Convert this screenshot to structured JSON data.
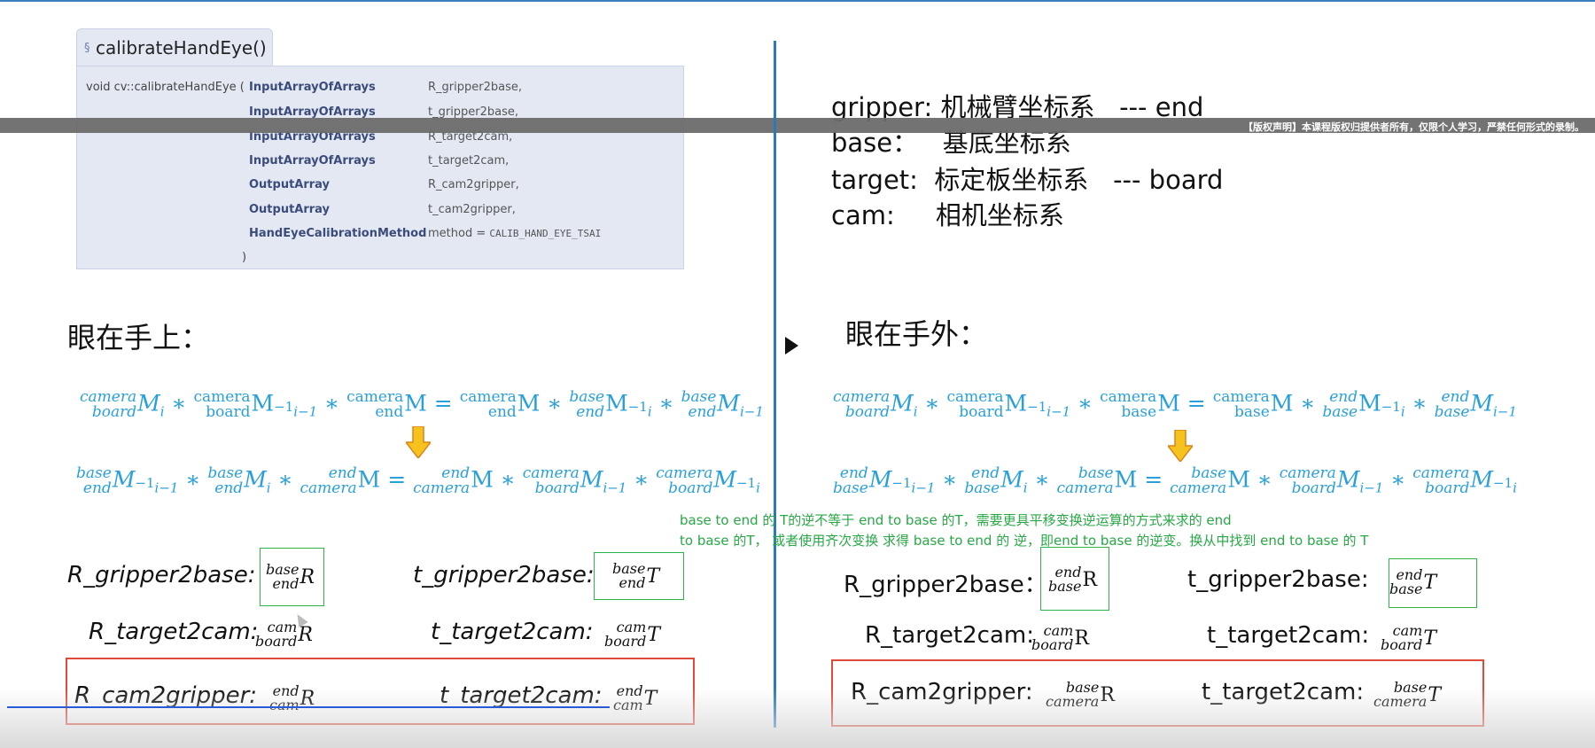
{
  "api": {
    "section_mark": "§",
    "function_title": "calibrateHandEye()",
    "signature": "void cv::calibrateHandEye (",
    "params": [
      {
        "type": "InputArrayOfArrays",
        "name": "R_gripper2base,"
      },
      {
        "type": "InputArrayOfArrays",
        "name": "t_gripper2base,"
      },
      {
        "type": "InputArrayOfArrays",
        "name": "R_target2cam,"
      },
      {
        "type": "InputArrayOfArrays",
        "name": "t_target2cam,"
      },
      {
        "type": "OutputArray",
        "name": "R_cam2gripper,"
      },
      {
        "type": "OutputArray",
        "name": "t_cam2gripper,"
      },
      {
        "type": "HandEyeCalibrationMethod",
        "name": "method = ",
        "default": "CALIB_HAND_EYE_TSAI"
      }
    ],
    "closing": ")"
  },
  "overlay": {
    "copyright": "【版权声明】本课程版权归提供者所有，仅限个人学习，严禁任何形式的录制。"
  },
  "coords": [
    {
      "key": "gripper:",
      "desc": "机械臂坐标系",
      "alias": "--- end"
    },
    {
      "key": "base：",
      "desc": "基底坐标系",
      "alias": ""
    },
    {
      "key": "target:",
      "desc": "标定板坐标系",
      "alias": "--- board"
    },
    {
      "key": "cam:",
      "desc": "相机坐标系",
      "alias": ""
    }
  ],
  "left": {
    "heading": "眼在手上：",
    "labels": {
      "r_g2b": "R_gripper2base:",
      "t_g2b": "t_gripper2base:",
      "r_t2c": "R_target2cam:",
      "t_t2c": "t_target2cam:",
      "r_c2g": "R_cam2gripper:",
      "t_c2g": "t_target2cam:"
    }
  },
  "right": {
    "heading": "眼在手外：",
    "labels": {
      "r_g2b": "R_gripper2base：",
      "t_g2b": "t_gripper2base:",
      "r_t2c": "R_target2cam:",
      "t_t2c": "t_target2cam:",
      "r_c2g": "R_cam2gripper:",
      "t_c2g": "t_target2cam:"
    }
  },
  "note": {
    "line1": "base to end 的 T的逆不等于 end to base 的T，需要更具平移变换逆运算的方式来求的 end",
    "line2": " to base 的T，  或者使用齐次变换 求得 base to end 的 逆，即end to base 的逆变。换从中找到 end to base 的 T"
  },
  "math": {
    "camera": "camera",
    "board": "board",
    "end": "end",
    "base": "base",
    "cam": "cam",
    "M": "M",
    "R": "R",
    "T": "T",
    "i": "i",
    "i_minus_1": "i−1",
    "inv": "−1",
    "times": "∗",
    "eq": "="
  },
  "colors": {
    "formula": "#2aa0db",
    "note": "#27a845",
    "green_box": "#2fb34a",
    "red_box": "#e04a3a",
    "divider": "#2a7ab8"
  }
}
